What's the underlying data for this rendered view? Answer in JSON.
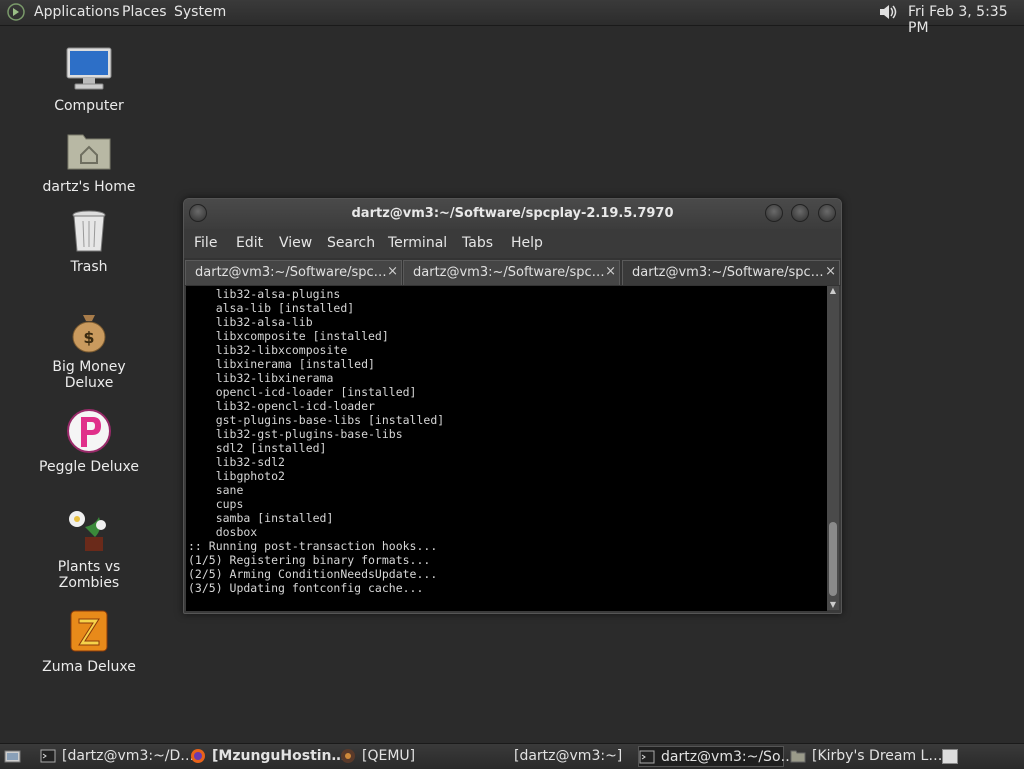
{
  "top_panel": {
    "applications": "Applications",
    "places": "Places",
    "system": "System",
    "clock": "Fri Feb  3,  5:35 PM"
  },
  "desktop_icons": [
    {
      "label": "Computer"
    },
    {
      "label": "dartz's Home"
    },
    {
      "label": "Trash"
    },
    {
      "label": "Big Money Deluxe"
    },
    {
      "label": "Peggle Deluxe"
    },
    {
      "label": "Plants vs Zombies"
    },
    {
      "label": "Zuma Deluxe"
    }
  ],
  "terminal": {
    "title": "dartz@vm3:~/Software/spcplay-2.19.5.7970",
    "menu": [
      "File",
      "Edit",
      "View",
      "Search",
      "Terminal",
      "Tabs",
      "Help"
    ],
    "tabs": [
      {
        "label": "dartz@vm3:~/Software/spc…",
        "close": "×"
      },
      {
        "label": "dartz@vm3:~/Software/spc…",
        "close": "×"
      },
      {
        "label": "dartz@vm3:~/Software/spc…",
        "close": "×"
      }
    ],
    "lines": [
      "    lib32-alsa-plugins",
      "    alsa-lib [installed]",
      "    lib32-alsa-lib",
      "    libxcomposite [installed]",
      "    lib32-libxcomposite",
      "    libxinerama [installed]",
      "    lib32-libxinerama",
      "    opencl-icd-loader [installed]",
      "    lib32-opencl-icd-loader",
      "    gst-plugins-base-libs [installed]",
      "    lib32-gst-plugins-base-libs",
      "    sdl2 [installed]",
      "    lib32-sdl2",
      "    libgphoto2",
      "    sane",
      "    cups",
      "    samba [installed]",
      "    dosbox",
      ":: Running post-transaction hooks...",
      "(1/5) Registering binary formats...",
      "(2/5) Arming ConditionNeedsUpdate...",
      "(3/5) Updating fontconfig cache..."
    ]
  },
  "taskbar": [
    {
      "label": "[dartz@vm3:~/D…"
    },
    {
      "label": "[MzunguHostin…"
    },
    {
      "label": "[QEMU]"
    },
    {
      "label": "[dartz@vm3:~]"
    },
    {
      "label": "dartz@vm3:~/So…"
    },
    {
      "label": "[Kirby's Dream L…"
    }
  ],
  "colors": {
    "desktop": "#2b2b2b",
    "terminal_bg": "#000000",
    "terminal_fg": "#d6d6d6"
  }
}
